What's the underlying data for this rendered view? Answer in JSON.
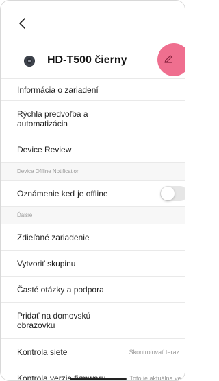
{
  "device": {
    "name": "HD-T500 čierny"
  },
  "icons": {
    "back": "chevron-left-icon",
    "edit": "pencil-icon",
    "chevron": "chevron-right-icon"
  },
  "colors": {
    "edit_button": "#ef6f8f",
    "toggle_off": "#e6e6e6"
  },
  "items": {
    "device_info": "Informácia o zariadení",
    "quick_scenes": "Rýchla predvoľba a automatizácia",
    "device_review": "Device Review",
    "offline_section": "Device Offline Notification",
    "offline_notify": "Oznámenie keď je offline",
    "offline_notify_enabled": false,
    "other_section": "Ďalšie",
    "share": "Zdieľané zariadenie",
    "create_group": "Vytvoriť skupinu",
    "faq": "Časté otázky a podpora",
    "add_home": "Pridať na domovskú obrazovku",
    "network_check": "Kontrola siete",
    "network_check_value": "Skontrolovať teraz",
    "firmware": "Kontrola verzie firmwaru",
    "firmware_value": "Toto je aktuálna ve..."
  }
}
